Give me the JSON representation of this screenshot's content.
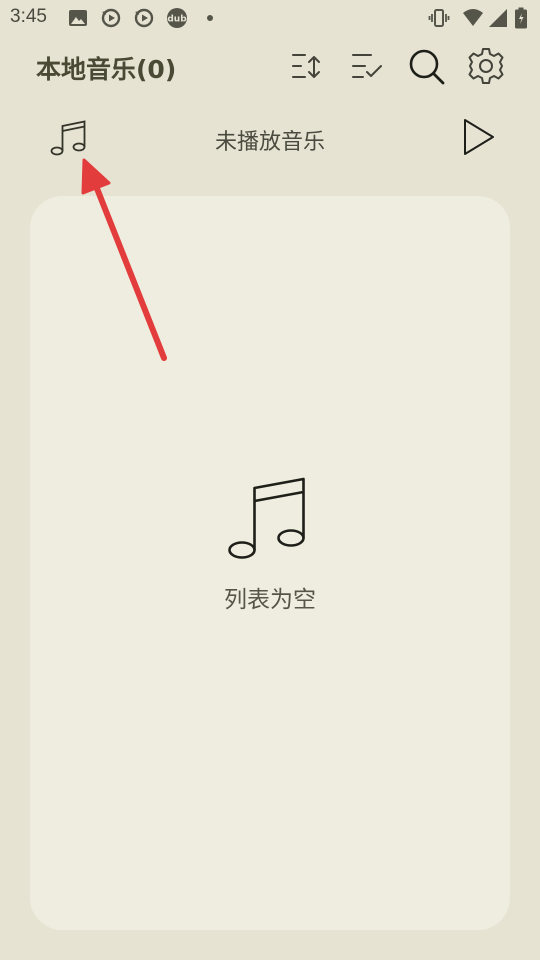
{
  "status_bar": {
    "time": "3:45",
    "dub_label": "dub",
    "notification_icons": [
      "image-icon",
      "sync-play-icon",
      "sync-play-icon",
      "dub-icon",
      "dot-icon"
    ],
    "system_icons": [
      "vibrate-icon",
      "wifi-icon",
      "signal-icon",
      "battery-icon"
    ]
  },
  "header": {
    "title": "本地音乐(0)",
    "actions": [
      "sort-icon",
      "multi-select-icon",
      "search-icon",
      "settings-icon"
    ]
  },
  "now_playing": {
    "text": "未播放音乐"
  },
  "list": {
    "empty_text": "列表为空"
  },
  "colors": {
    "background": "#e6e3d3",
    "card": "#efeddf",
    "title": "#4a4a34",
    "annotation_arrow": "#e23c3c"
  }
}
